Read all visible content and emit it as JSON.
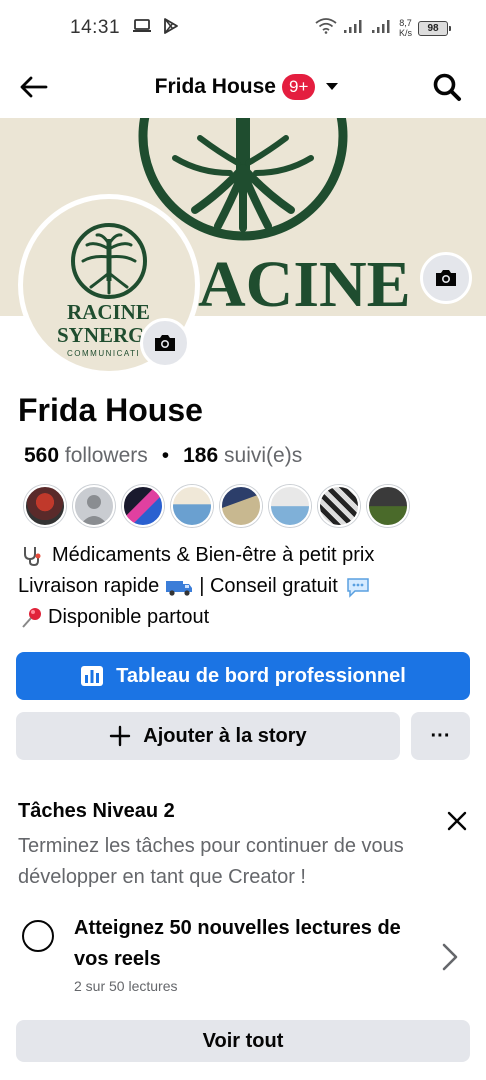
{
  "status_bar": {
    "time": "14:31",
    "net_speed_value": "8,7",
    "net_speed_unit": "K/s",
    "battery": "98",
    "icons": [
      "laptop-icon",
      "play-store-icon",
      "wifi-icon",
      "signal-icon",
      "signal-icon",
      "battery-icon"
    ]
  },
  "header": {
    "title": "Frida House",
    "notifications_badge": "9+",
    "icons": [
      "back-arrow-icon",
      "caret-down-icon",
      "search-icon"
    ]
  },
  "cover": {
    "text": "ACINE",
    "colors": {
      "background": "#ebe5d5",
      "logo": "#1f4d2f"
    }
  },
  "avatar": {
    "line1": "RACINE",
    "line2": "SYNERGI",
    "line3": "COMMUNICATI"
  },
  "profile": {
    "name": "Frida House",
    "followers_count": "560",
    "followers_label": "followers",
    "following_count": "186",
    "following_label": "suivi(e)s",
    "separator": "•"
  },
  "followers_preview": [
    "follower-1",
    "follower-2",
    "follower-3",
    "follower-4",
    "follower-5",
    "follower-6",
    "follower-7",
    "follower-8"
  ],
  "bio": {
    "line1": "Médicaments & Bien-être à petit prix",
    "line2": "Livraison rapide",
    "line2_suffix": "| Conseil gratuit",
    "line3": "Disponible partout",
    "emojis": [
      "stethoscope-icon",
      "delivery-truck-icon",
      "speech-bubble-icon",
      "pushpin-icon"
    ]
  },
  "actions": {
    "dashboard_label": "Tableau de bord professionnel",
    "add_story_label": "Ajouter à la story",
    "more_label": "···"
  },
  "tasks": {
    "title": "Tâches Niveau 2",
    "description": "Terminez les tâches pour continuer de vous développer en tant que Creator !",
    "item": {
      "title": "Atteignez 50 nouvelles lectures de vos reels",
      "progress_text": "2 sur 50 lectures",
      "progress_value": 2,
      "progress_total": 50
    },
    "see_all_label": "Voir tout"
  },
  "colors": {
    "primary": "#1b74e4",
    "secondary_bg": "#e4e6eb",
    "badge": "#e41e3f",
    "muted_text": "#65676b"
  }
}
